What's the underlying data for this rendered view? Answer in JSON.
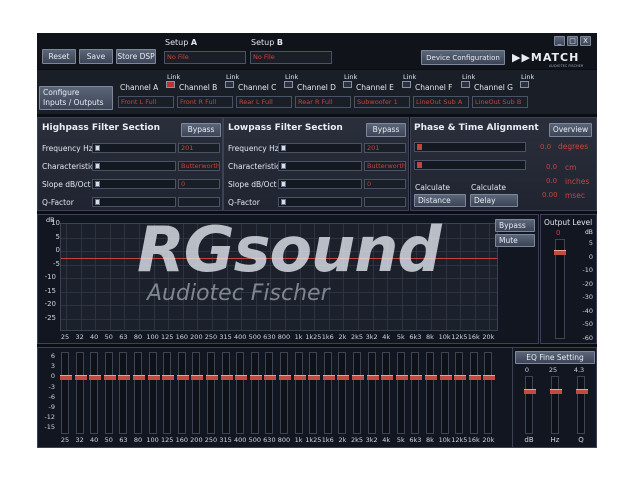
{
  "toolbar": {
    "reset": "Reset",
    "save": "Save",
    "store_dsp": "Store DSP",
    "setup_prefix": "Setup",
    "setup_a_letter": "A",
    "setup_b_letter": "B",
    "setup_a_value": "No File",
    "setup_b_value": "No File",
    "device_config": "Device Configuration",
    "logo": "MATCH",
    "logo_sub": "AUDIOTEC FISCHER"
  },
  "window_controls": [
    "_",
    "□",
    "X"
  ],
  "configure": {
    "line1": "Configure",
    "line2": "Inputs / Outputs"
  },
  "link_label": "Link",
  "channels": [
    {
      "name": "Channel A",
      "output": "Front L Full",
      "linked": true
    },
    {
      "name": "Channel B",
      "output": "Front R Full",
      "linked": false
    },
    {
      "name": "Channel C",
      "output": "Rear L Full",
      "linked": false
    },
    {
      "name": "Channel D",
      "output": "Rear R Full",
      "linked": false
    },
    {
      "name": "Channel E",
      "output": "Subwoofer 1",
      "linked": false
    },
    {
      "name": "Channel F",
      "output": "LineOut Sub A",
      "linked": false
    },
    {
      "name": "Channel G",
      "output": "LineOut Sub B",
      "linked": false
    }
  ],
  "highpass": {
    "title": "Highpass Filter Section",
    "bypass": "Bypass",
    "rows": [
      {
        "label": "Frequency Hz",
        "value": "201"
      },
      {
        "label": "Characteristic",
        "value": "Butterworth"
      },
      {
        "label": "Slope dB/Oct",
        "value": "0"
      },
      {
        "label": "Q-Factor",
        "value": ""
      }
    ]
  },
  "lowpass": {
    "title": "Lowpass Filter Section",
    "bypass": "Bypass",
    "rows": [
      {
        "label": "Frequency Hz",
        "value": "201"
      },
      {
        "label": "Characteristic",
        "value": "Butterworth"
      },
      {
        "label": "Slope dB/Oct",
        "value": "0"
      },
      {
        "label": "Q-Factor",
        "value": ""
      }
    ]
  },
  "phase": {
    "title": "Phase & Time Alignment",
    "overview": "Overview",
    "degrees_value": "0.0",
    "degrees_unit": "degrees",
    "cm_value": "0.0",
    "cm_unit": "cm",
    "inches_value": "0.0",
    "inches_unit": "inches",
    "msec_value": "0.00",
    "msec_unit": "msec",
    "calculate": "Calculate",
    "distance": "Distance",
    "delay": "Delay"
  },
  "response": {
    "db_label": "dB",
    "y_ticks": [
      "10",
      "5",
      "0",
      "-5",
      "-10",
      "-15",
      "-20",
      "-25"
    ],
    "bypass": "Bypass",
    "mute": "Mute"
  },
  "freq_ticks": [
    "25",
    "32",
    "40",
    "50",
    "63",
    "80",
    "100",
    "125",
    "160",
    "200",
    "250",
    "315",
    "400",
    "500",
    "630",
    "800",
    "1k",
    "1k25",
    "1k6",
    "2k",
    "2k5",
    "3k2",
    "4k",
    "5k",
    "6k3",
    "8k",
    "10k",
    "12k5",
    "16k",
    "20k"
  ],
  "output_level": {
    "title": "Output Level",
    "db_label": "dB",
    "value": "0",
    "ticks": [
      "5",
      "0",
      "-10",
      "-20",
      "-30",
      "-40",
      "-50",
      "-60"
    ]
  },
  "eq": {
    "y_ticks": [
      "6",
      "3",
      "0",
      "-3",
      "-6",
      "-9",
      "-12",
      "-15"
    ],
    "fine_title": "EQ Fine Setting",
    "fine_values": [
      "0",
      "25",
      "4.3"
    ],
    "fine_labels": [
      "dB",
      "Hz",
      "Q"
    ]
  },
  "watermark": {
    "main": "RGsound",
    "sub": "Audiotec Fischer"
  },
  "colors": {
    "accent": "#c2453d",
    "bg": "#0b0d12",
    "panel": "#262b37"
  }
}
